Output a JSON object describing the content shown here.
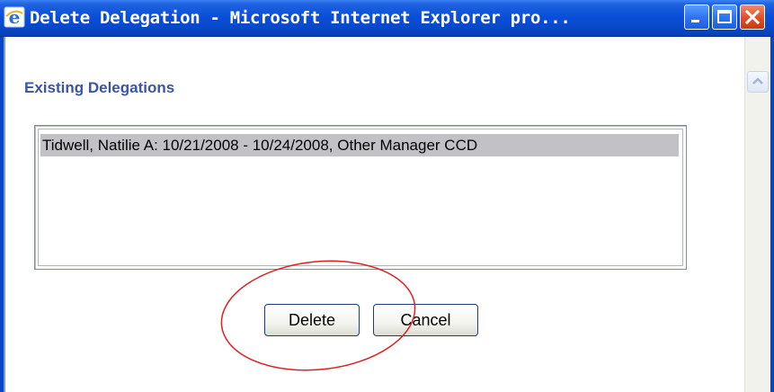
{
  "window": {
    "title": "Delete Delegation - Microsoft Internet Explorer pro...",
    "icon": "internet-explorer-icon",
    "controls": [
      "minimize",
      "maximize",
      "close"
    ]
  },
  "page": {
    "heading": "Existing Delegations",
    "delegations": [
      "Tidwell, Natilie A: 10/21/2008 - 10/24/2008, Other Manager CCD"
    ],
    "selected_index": 0,
    "buttons": {
      "delete": "Delete",
      "cancel": "Cancel"
    }
  },
  "colors": {
    "titlebar": "#0a4fd8",
    "heading": "#3a55a3",
    "selection": "#c2c2c6",
    "annotation": "#e02020"
  }
}
